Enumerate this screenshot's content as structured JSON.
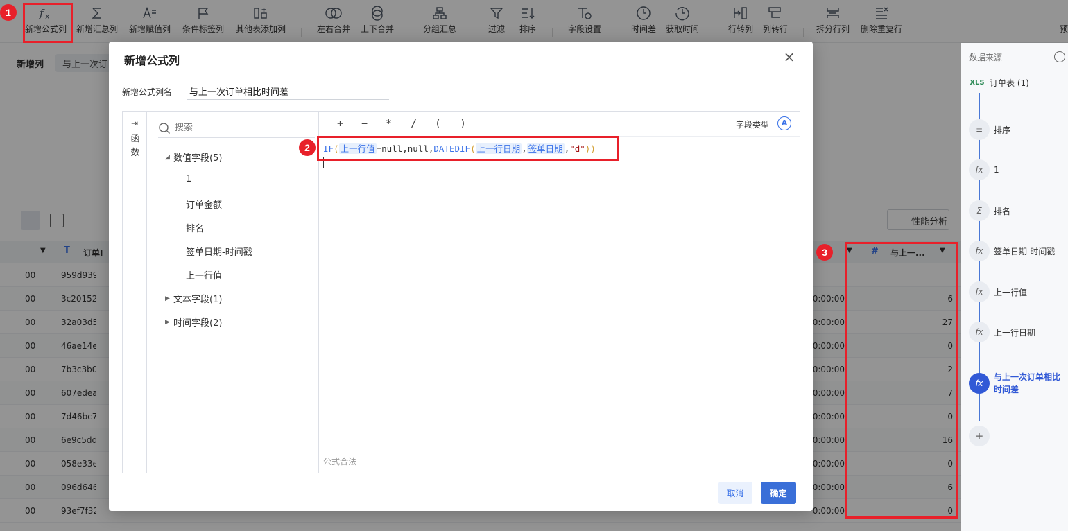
{
  "toolbar": {
    "items": [
      {
        "label": "新增公式列",
        "icon": "fx-icon"
      },
      {
        "label": "新增汇总列",
        "icon": "sigma-icon"
      },
      {
        "label": "新增赋值列",
        "icon": "assign-icon"
      },
      {
        "label": "条件标签列",
        "icon": "flag-icon"
      },
      {
        "label": "其他表添加列",
        "icon": "add-column-icon"
      },
      {
        "label": "左右合并",
        "icon": "merge-lr-icon"
      },
      {
        "label": "上下合并",
        "icon": "merge-ud-icon"
      },
      {
        "label": "分组汇总",
        "icon": "group-icon"
      },
      {
        "label": "过滤",
        "icon": "filter-icon"
      },
      {
        "label": "排序",
        "icon": "sort-icon"
      },
      {
        "label": "字段设置",
        "icon": "field-setting-icon"
      },
      {
        "label": "时间差",
        "icon": "clock-icon"
      },
      {
        "label": "获取时间",
        "icon": "clock-history-icon"
      },
      {
        "label": "行转列",
        "icon": "row-to-col-icon"
      },
      {
        "label": "列转行",
        "icon": "col-to-row-icon"
      },
      {
        "label": "拆分行列",
        "icon": "split-icon"
      },
      {
        "label": "删除重复行",
        "icon": "dedupe-icon"
      }
    ],
    "right_cut_label": "预"
  },
  "background": {
    "tab_label": "新增列",
    "step_label": "与上一次订",
    "perf_button": "性能分析",
    "col_header_id": "订单I",
    "col_header_last": "与上一...",
    "rows": [
      {
        "a": "00",
        "id": "959d939b-6",
        "time": "",
        "val": ""
      },
      {
        "a": "00",
        "id": "3c201528-8",
        "time": "0:00:00",
        "val": "6"
      },
      {
        "a": "00",
        "id": "32a03d53-7",
        "time": "0:00:00",
        "val": "27"
      },
      {
        "a": "00",
        "id": "46ae14ec-6",
        "time": "0:00:00",
        "val": "0"
      },
      {
        "a": "00",
        "id": "7b3c3b06-4",
        "time": "0:00:00",
        "val": "2"
      },
      {
        "a": "00",
        "id": "607edea6-b",
        "time": "0:00:00",
        "val": "7"
      },
      {
        "a": "00",
        "id": "7d46bc71-1",
        "time": "0:00:00",
        "val": "0"
      },
      {
        "a": "00",
        "id": "6e9c5ddc-d",
        "time": "0:00:00",
        "val": "16"
      },
      {
        "a": "00",
        "id": "058e33e0-1",
        "time": "0:00:00",
        "val": "0"
      },
      {
        "a": "00",
        "id": "096d646e-4",
        "time": "0:00:00",
        "val": "6"
      },
      {
        "a": "00",
        "id": "93ef7f32-46",
        "time": "0:00:00",
        "val": "0"
      }
    ]
  },
  "process_panel": {
    "title": "数据来源",
    "nodes": [
      {
        "icon": "XLS",
        "label": "订单表 (1)"
      },
      {
        "icon": "≡",
        "label": "排序"
      },
      {
        "icon": "fx",
        "label": "1"
      },
      {
        "icon": "Σ",
        "label": "排名"
      },
      {
        "icon": "fx",
        "label": "签单日期-时间戳"
      },
      {
        "icon": "fx",
        "label": "上一行值"
      },
      {
        "icon": "fx",
        "label": "上一行日期"
      },
      {
        "icon": "fx",
        "label": "与上一次订单相比时间差"
      }
    ],
    "add": "+"
  },
  "dialog": {
    "title": "新增公式列",
    "close": "×",
    "name_label": "新增公式列名",
    "name_value": "与上一次订单相比时间差",
    "fn_tab": "函数",
    "search_placeholder": "搜索",
    "groups": [
      {
        "label": "数值字段(5)",
        "expanded": true,
        "items": [
          "1",
          "订单金额",
          "排名",
          "签单日期-时间戳",
          "上一行值"
        ]
      },
      {
        "label": "文本字段(1)",
        "expanded": false,
        "items": []
      },
      {
        "label": "时间字段(2)",
        "expanded": false,
        "items": []
      }
    ],
    "operators": [
      "+",
      "−",
      "*",
      "/",
      "(",
      ")"
    ],
    "field_type_label": "字段类型",
    "field_type_icon": "A",
    "formula": {
      "p1": "IF",
      "p2": "(",
      "f1": "上一行值",
      "p3": "=null,null,",
      "p4": "DATEDIF",
      "p5": "(",
      "f2": "上一行日期",
      "p6": ",",
      "f3": "签单日期",
      "p7": ",",
      "s1": "\"d\"",
      "p8": "))"
    },
    "valid_text": "公式合法",
    "cancel": "取消",
    "ok": "确定"
  },
  "badges": [
    "1",
    "2",
    "3"
  ],
  "colors": {
    "accent": "#3a6fd8",
    "highlight": "#e8202a"
  }
}
